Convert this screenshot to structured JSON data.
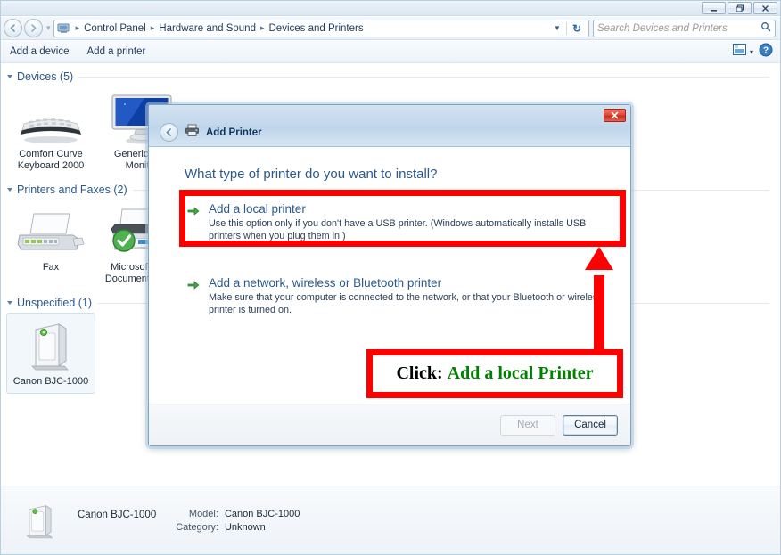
{
  "window": {
    "titlebar_buttons": [
      {
        "name": "minimize",
        "glyph": "─"
      },
      {
        "name": "restore",
        "glyph": "❐"
      },
      {
        "name": "close",
        "glyph": "✕"
      }
    ],
    "breadcrumb": [
      "Control Panel",
      "Hardware and Sound",
      "Devices and Printers"
    ],
    "breadcrumb_separator": "▸",
    "address_dropdown_glyph": "▼",
    "refresh_glyph": "↻",
    "back_glyph": "◀",
    "forward_glyph": "▶",
    "nav_separator_glyph": "▾",
    "search": {
      "placeholder": "Search Devices and Printers",
      "icon": "search-icon",
      "value": ""
    }
  },
  "commandbar": {
    "items": [
      {
        "name": "add-a-device",
        "label": "Add a device"
      },
      {
        "name": "add-a-printer",
        "label": "Add a printer"
      }
    ],
    "view_dropdown_glyph": "▾",
    "help_glyph": "?"
  },
  "content": {
    "groups": [
      {
        "name": "devices",
        "label": "Devices (5)",
        "items": [
          {
            "name": "comfort-curve-keyboard-2000",
            "label": "Comfort Curve\nKeyboard 2000",
            "icon": "keyboard-icon"
          },
          {
            "name": "generic-pnp-monitor",
            "label": "Generic PnP\nMonitor",
            "icon": "monitor-icon"
          }
        ]
      },
      {
        "name": "printers-and-faxes",
        "label": "Printers and Faxes (2)",
        "items": [
          {
            "name": "fax",
            "label": "Fax",
            "icon": "fax-icon"
          },
          {
            "name": "microsoft-xps-document-writer",
            "label": "Microsoft XPS\nDocument Writer",
            "icon": "printer-icon",
            "badge": "default-check"
          }
        ]
      },
      {
        "name": "unspecified",
        "label": "Unspecified (1)",
        "items": [
          {
            "name": "canon-bjc-1000",
            "label": "Canon BJC-1000",
            "icon": "unspecified-device-icon",
            "selected": true
          }
        ]
      }
    ]
  },
  "details": {
    "device_name": "Canon BJC-1000",
    "fields": [
      {
        "key": "Model:",
        "value": "Canon BJC-1000"
      },
      {
        "key": "Category:",
        "value": "Unknown"
      }
    ]
  },
  "dialog": {
    "title": "Add Printer",
    "title_icon": "printer-icon",
    "back_glyph": "◀",
    "close_glyph": "✕",
    "question": "What type of printer do you want to install?",
    "options": [
      {
        "name": "add-a-local-printer",
        "title": "Add a local printer",
        "description": "Use this option only if you don't have a USB printer. (Windows automatically installs USB printers when you plug them in.)",
        "highlighted": true
      },
      {
        "name": "add-a-network-wireless-or-bluetooth-printer",
        "title": "Add a network, wireless or Bluetooth printer",
        "description": "Make sure that your computer is connected to the network, or that your Bluetooth or wireless printer is turned on.",
        "highlighted": false
      }
    ],
    "buttons": [
      {
        "name": "next-button",
        "label": "Next",
        "disabled": true
      },
      {
        "name": "cancel-button",
        "label": "Cancel",
        "disabled": false
      }
    ]
  },
  "annotation": {
    "callout_prefix": "Click:",
    "callout_target": "Add a local Printer",
    "highlight_color": "#fe0000",
    "target_text_color": "#008000",
    "prefix_text_color": "#000000"
  }
}
